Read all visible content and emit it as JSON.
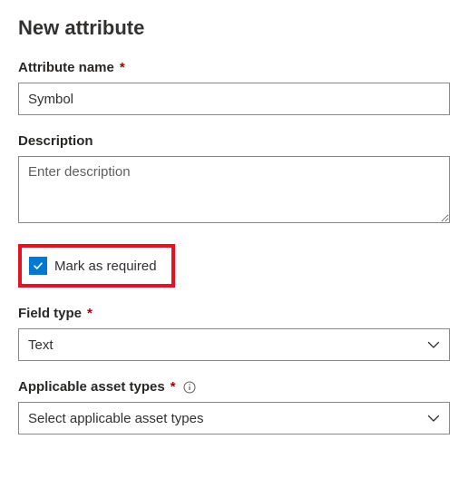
{
  "title": "New attribute",
  "attributeName": {
    "label": "Attribute name",
    "value": "Symbol",
    "required": true
  },
  "description": {
    "label": "Description",
    "placeholder": "Enter description",
    "value": ""
  },
  "markAsRequired": {
    "label": "Mark as required",
    "checked": true
  },
  "fieldType": {
    "label": "Field type",
    "required": true,
    "selected": "Text"
  },
  "applicableAssetTypes": {
    "label": "Applicable asset types",
    "required": true,
    "placeholder": "Select applicable asset types"
  },
  "symbols": {
    "asterisk": "*"
  }
}
